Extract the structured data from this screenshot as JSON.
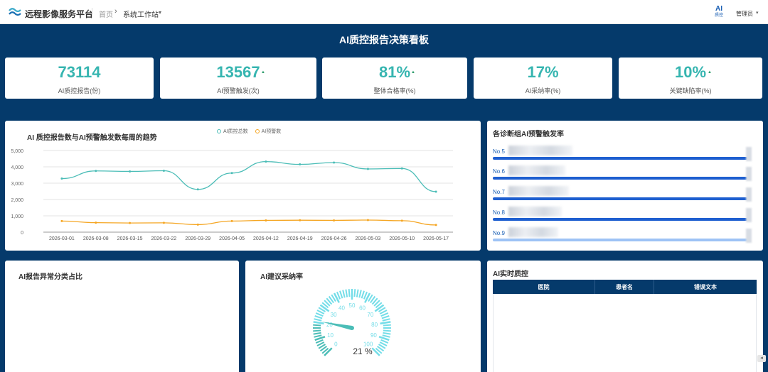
{
  "header": {
    "app_title": "远程影像服务平台",
    "breadcrumb": {
      "home": "首页",
      "separator": "›",
      "current": "系统工作站",
      "caret": "▾"
    },
    "ai_badge": {
      "top": "AI",
      "bottom": "质控"
    },
    "user": {
      "label": "管理员",
      "caret": "▾"
    }
  },
  "dashboard_title": "AI质控报告决策看板",
  "kpis": [
    {
      "value": "73114",
      "label": "AI质控报告(份)",
      "trend_up": false
    },
    {
      "value": "13567",
      "label": "AI预警触发(次)",
      "trend_up": true
    },
    {
      "value": "81%",
      "label": "整体合格率(%)",
      "trend_up": true
    },
    {
      "value": "17%",
      "label": "AI采纳率(%)",
      "trend_up": false
    },
    {
      "value": "10%",
      "label": "关键缺陷率(%)",
      "trend_up": true
    }
  ],
  "trend_up_glyph": "▲",
  "trend_panel": {
    "title": "AI 质控报告数与AI预警触发数每周的趋势"
  },
  "chart_data": {
    "type": "line",
    "title": "AI 质控报告数与AI预警触发数每周的趋势",
    "x": [
      "2026-03-01",
      "2026-03-08",
      "2026-03-15",
      "2026-03-22",
      "2026-03-29",
      "2026-04-05",
      "2026-04-12",
      "2026-04-19",
      "2026-04-26",
      "2026-05-03",
      "2026-05-10",
      "2026-05-17"
    ],
    "yticks": [
      "0",
      "1,000",
      "2,000",
      "3,000",
      "4,000",
      "5,000"
    ],
    "ylim": [
      0,
      5000
    ],
    "series": [
      {
        "name": "AI质控总数",
        "color": "#4bbdb7",
        "values": [
          3280,
          3750,
          3720,
          3760,
          2620,
          3620,
          4320,
          4150,
          4260,
          3870,
          3900,
          2480
        ]
      },
      {
        "name": "AI预警数",
        "color": "#f5a623",
        "values": [
          680,
          580,
          560,
          570,
          460,
          680,
          720,
          730,
          720,
          740,
          700,
          440
        ]
      }
    ],
    "grid": true,
    "legend": "top"
  },
  "group_panel": {
    "title": "各诊断组AI预警触发率",
    "rows": [
      {
        "label": "No.5"
      },
      {
        "label": "No.6"
      },
      {
        "label": "No.7"
      },
      {
        "label": "No.8"
      },
      {
        "label": "No.9"
      }
    ]
  },
  "category_panel": {
    "title": "AI报告异常分类占比"
  },
  "gauge_panel": {
    "title": "AI建议采纳率",
    "value": 21,
    "value_text": "21 %",
    "ticks": [
      "0",
      "10",
      "20",
      "30",
      "40",
      "50",
      "60",
      "70",
      "80",
      "90",
      "100"
    ]
  },
  "realtime_panel": {
    "title": "AI实时质控",
    "columns": [
      "医院",
      "患者名",
      "错误文本"
    ]
  },
  "scroll_glyph": "◂"
}
